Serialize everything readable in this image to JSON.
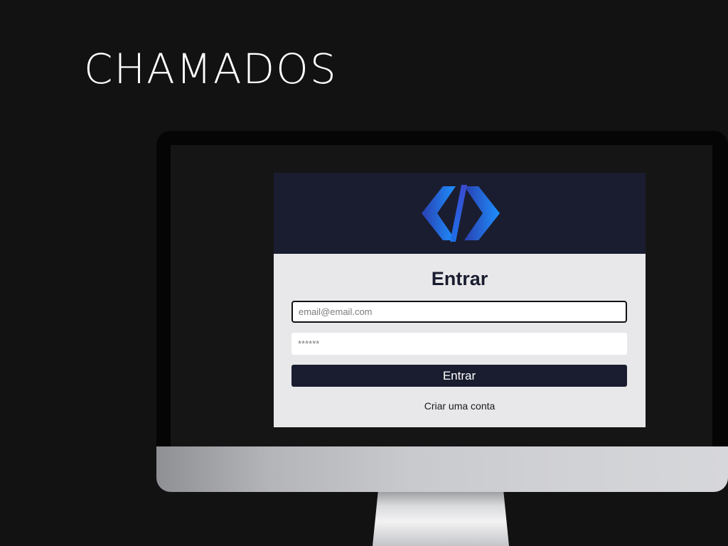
{
  "page": {
    "title": "CHAMADOS"
  },
  "login": {
    "logo_icon": "code-brackets-logo-icon",
    "heading": "Entrar",
    "email_placeholder": "email@email.com",
    "email_value": "",
    "password_placeholder": "******",
    "password_value": "",
    "submit_label": "Entrar",
    "signup_link": "Criar uma conta"
  },
  "colors": {
    "background": "#121212",
    "card_header": "#1a1d30",
    "card_body": "#e8e8ea",
    "button": "#1a1d30",
    "logo_gradient_start": "#2a3fb0",
    "logo_gradient_end": "#1e90ff"
  }
}
